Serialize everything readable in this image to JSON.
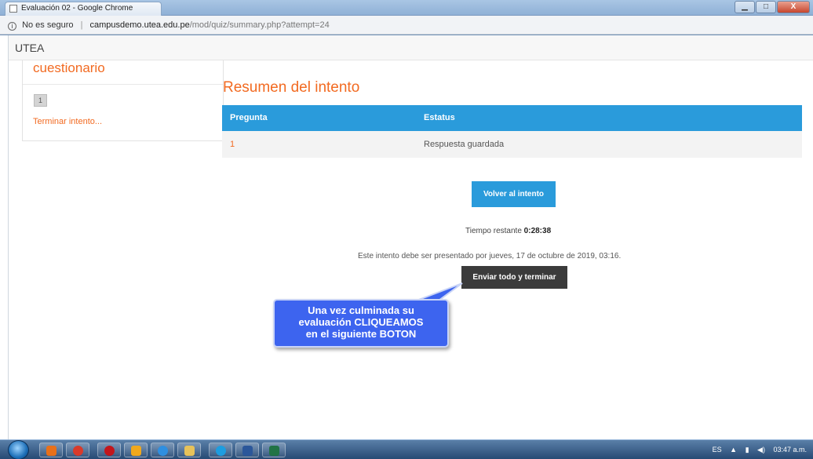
{
  "window": {
    "tab_title": "Evaluación 02 - Google Chrome",
    "min_label": "▁",
    "max_label": "□",
    "close_label": "X"
  },
  "address": {
    "security_label": "No es seguro",
    "url_host": "campusdemo.utea.edu.pe",
    "url_path": "/mod/quiz/summary.php?attempt=24"
  },
  "navbar": {
    "site_name": "UTEA"
  },
  "quiz_nav": {
    "title": "cuestionario",
    "question_buttons": [
      "1"
    ],
    "finish_link": "Terminar intento..."
  },
  "main": {
    "title": "Resumen del intento",
    "table": {
      "headers": [
        "Pregunta",
        "Estatus"
      ],
      "rows": [
        {
          "question": "1",
          "status": "Respuesta guardada"
        }
      ]
    },
    "return_button": "Volver al intento",
    "time_left_label": "Tiempo restante",
    "time_left_value": "0:28:38",
    "deadline_text": "Este intento debe ser presentado por jueves, 17 de octubre de 2019, 03:16.",
    "submit_button": "Enviar todo y terminar"
  },
  "callout": {
    "line1": "Una vez culminada su",
    "line2": "evaluación CLIQUEAMOS",
    "line3": "en el siguiente BOTON"
  },
  "taskbar": {
    "language": "ES",
    "clock": "03:47 a.m.",
    "apps": [
      "firefox-icon",
      "chrome-icon",
      "opera-icon",
      "media-icon",
      "ie-icon",
      "explorer-icon",
      "skype-icon",
      "word-icon",
      "excel-icon"
    ]
  }
}
